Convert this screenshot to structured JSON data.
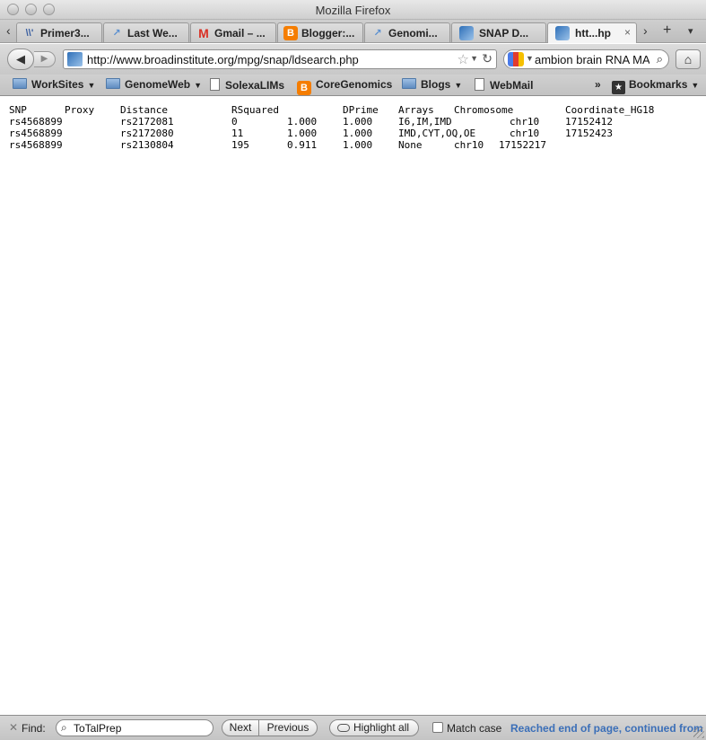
{
  "window": {
    "title": "Mozilla Firefox"
  },
  "tabs": [
    {
      "label": "Primer3...",
      "icon": "primer3-favicon",
      "active": false
    },
    {
      "label": "Last We...",
      "icon": "genomeweb-favicon",
      "active": false
    },
    {
      "label": "Gmail – ...",
      "icon": "gmail-favicon",
      "active": false
    },
    {
      "label": "Blogger:...",
      "icon": "blogger-favicon",
      "active": false
    },
    {
      "label": "Genomi...",
      "icon": "genomeweb-favicon",
      "active": false
    },
    {
      "label": "SNAP D...",
      "icon": "broad-favicon",
      "active": false
    },
    {
      "label": "htt...hp",
      "icon": "broad-favicon",
      "active": true
    }
  ],
  "tabstrip": {
    "scroll_left_glyph": "‹",
    "scroll_right_glyph": "›",
    "new_tab_glyph": "+",
    "list_all_glyph": "▾",
    "close_glyph": "×"
  },
  "navigation": {
    "url": "http://www.broadinstitute.org/mpg/snap/ldsearch.php",
    "search_value": "ambion brain RNA MAQ",
    "back_glyph": "◀",
    "forward_glyph": "▶"
  },
  "bookmarks": [
    {
      "label": "WorkSites",
      "kind": "folder",
      "dropdown": true
    },
    {
      "label": "GenomeWeb",
      "kind": "folder",
      "dropdown": true
    },
    {
      "label": "SolexaLIMs",
      "kind": "page",
      "dropdown": false
    },
    {
      "label": "CoreGenomics",
      "kind": "blogger",
      "dropdown": false
    },
    {
      "label": "Blogs",
      "kind": "folder",
      "dropdown": true
    },
    {
      "label": "WebMail",
      "kind": "page",
      "dropdown": false
    }
  ],
  "bookmarks_overflow": "»",
  "bookmarks_menu": "Bookmarks",
  "result_table": {
    "headers": [
      "SNP",
      "Proxy",
      "Distance",
      "RSquared",
      "DPrime",
      "Arrays",
      "Chromosome",
      "Coordinate_HG18"
    ],
    "rows": [
      [
        "rs4568899",
        "rs2172081",
        "0",
        "1.000",
        "1.000",
        "I6,IM,IMD",
        "chr10",
        "17152412"
      ],
      [
        "rs4568899",
        "rs2172080",
        "11",
        "1.000",
        "1.000",
        "IMD,CYT,OQ,OE",
        "chr10",
        "17152423"
      ],
      [
        "rs4568899",
        "rs2130804",
        "195",
        "0.911",
        "1.000",
        "None",
        "chr10",
        "17152217"
      ]
    ]
  },
  "findbar": {
    "label": "Find:",
    "query": "ToTalPrep",
    "next_label": "Next",
    "previous_label": "Previous",
    "highlight_label": "Highlight all",
    "match_case_label": "Match case",
    "match_case_checked": false,
    "status": "Reached end of page, continued from top"
  },
  "colors": {
    "status_text": "#3b6fb8",
    "gmail_red": "#d93025",
    "blogger_orange": "#f57d00"
  }
}
